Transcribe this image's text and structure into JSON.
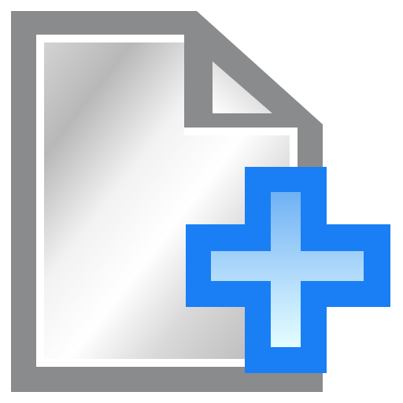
{
  "icon": {
    "name": "new-document-icon",
    "parts": {
      "document": "document-icon",
      "folded_corner": "folded-corner-icon",
      "plus_badge": "plus-icon"
    }
  },
  "colors": {
    "document_outline": "#8a8b8d",
    "document_fill_light": "#ffffff",
    "document_fill_mid": "#d6d6d6",
    "document_fill_dark": "#b9b9b9",
    "plus_outline": "#1a7ff5",
    "plus_fill_top": "#6fb1f4",
    "plus_fill_bottom": "#e4fdff"
  }
}
